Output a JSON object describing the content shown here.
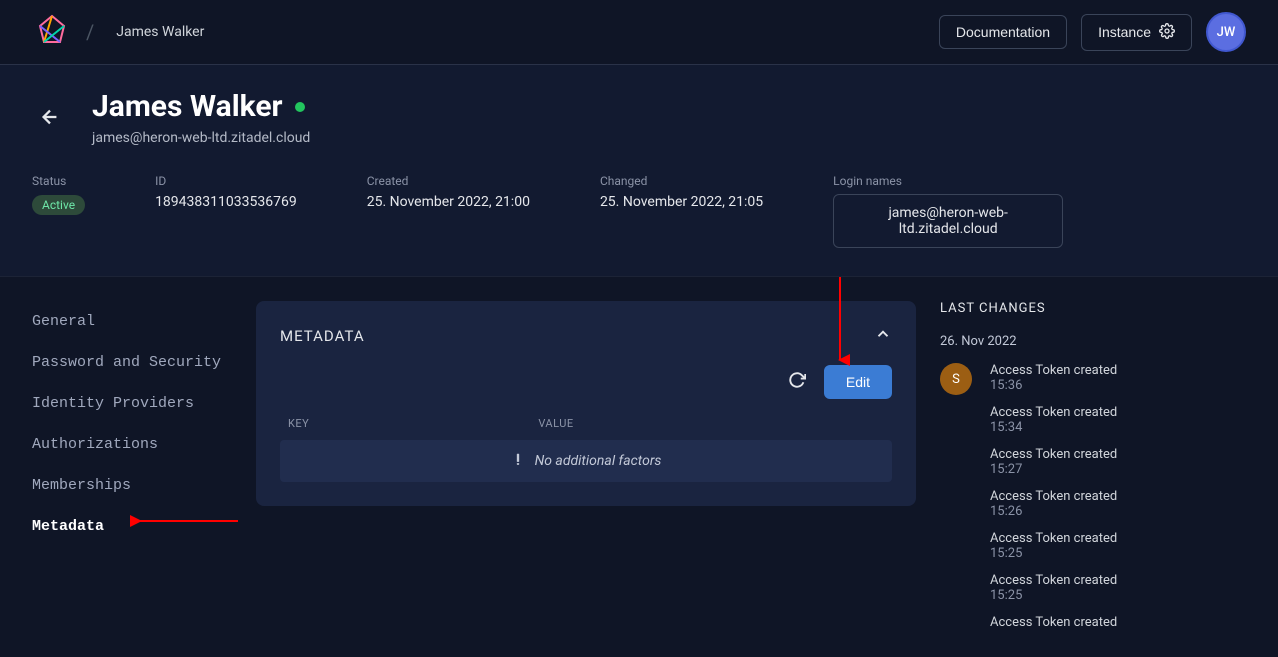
{
  "topbar": {
    "breadcrumb_name": "James Walker",
    "doc_label": "Documentation",
    "instance_label": "Instance",
    "avatar_initials": "JW"
  },
  "hero": {
    "title": "James Walker",
    "subtitle": "james@heron-web-ltd.zitadel.cloud",
    "fields": {
      "status_label": "Status",
      "status_value": "Active",
      "id_label": "ID",
      "id_value": "189438311033536769",
      "created_label": "Created",
      "created_value": "25. November 2022, 21:00",
      "changed_label": "Changed",
      "changed_value": "25. November 2022, 21:05",
      "loginnames_label": "Login names",
      "loginnames_value": "james@heron-web-ltd.zitadel.cloud"
    }
  },
  "sidebar": {
    "items": [
      "General",
      "Password and Security",
      "Identity Providers",
      "Authorizations",
      "Memberships",
      "Metadata"
    ]
  },
  "card": {
    "title": "METADATA",
    "edit_label": "Edit",
    "th_key": "KEY",
    "th_value": "VALUE",
    "empty_text": "No additional factors"
  },
  "changes": {
    "title": "LAST CHANGES",
    "date": "26. Nov 2022",
    "avatar_letter": "S",
    "items": [
      {
        "text": "Access Token created",
        "time": "15:36"
      },
      {
        "text": "Access Token created",
        "time": "15:34"
      },
      {
        "text": "Access Token created",
        "time": "15:27"
      },
      {
        "text": "Access Token created",
        "time": "15:26"
      },
      {
        "text": "Access Token created",
        "time": "15:25"
      },
      {
        "text": "Access Token created",
        "time": "15:25"
      },
      {
        "text": "Access Token created",
        "time": ""
      }
    ]
  }
}
